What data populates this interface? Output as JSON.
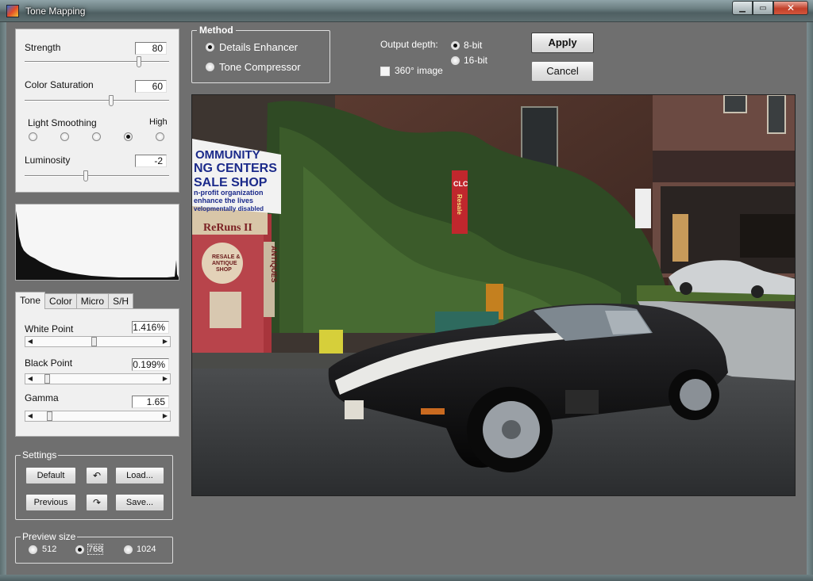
{
  "window": {
    "title": "Tone Mapping"
  },
  "adjust": {
    "strength": {
      "label": "Strength",
      "value": "80",
      "fraction": 0.8
    },
    "color_saturation": {
      "label": "Color Saturation",
      "value": "60",
      "fraction": 0.6
    },
    "light_smoothing": {
      "label": "Light Smoothing",
      "high_label": "High",
      "options": 5,
      "selected_index": 3
    },
    "luminosity": {
      "label": "Luminosity",
      "value": "-2",
      "fraction": 0.42
    }
  },
  "tabs": [
    {
      "label": "Tone",
      "active": true
    },
    {
      "label": "Color",
      "active": false
    },
    {
      "label": "Micro",
      "active": false
    },
    {
      "label": "S/H",
      "active": false
    }
  ],
  "tone": {
    "white_point": {
      "label": "White Point",
      "value": "1.416%",
      "fraction": 0.47
    },
    "black_point": {
      "label": "Black Point",
      "value": "0.199%",
      "fraction": 0.08
    },
    "gamma": {
      "label": "Gamma",
      "value": "1.65",
      "fraction": 0.1
    }
  },
  "settings": {
    "title": "Settings",
    "default_label": "Default",
    "load_label": "Load...",
    "previous_label": "Previous",
    "save_label": "Save..."
  },
  "preview_size": {
    "title": "Preview size",
    "options": [
      "512",
      "768",
      "1024"
    ],
    "selected": "768"
  },
  "method": {
    "title": "Method",
    "options": [
      "Details Enhancer",
      "Tone Compressor"
    ],
    "selected": "Details Enhancer"
  },
  "output": {
    "depth_label": "Output depth:",
    "depth_options": [
      "8-bit",
      "16-bit"
    ],
    "depth_selected": "8-bit",
    "image360_label": "360° image",
    "image360_checked": false
  },
  "actions": {
    "apply_label": "Apply",
    "cancel_label": "Cancel"
  },
  "preview_signs": {
    "community_line1": "OMMUNITY",
    "community_line2": "NG CENTERS",
    "community_line3": "SALE SHOP",
    "community_line4": "n-profit organization",
    "community_line5": "enhance the lives",
    "community_line6": "velopmentally disabled",
    "reruns": "ReRuns II",
    "resale_line1": "RESALE &",
    "resale_line2": "ANTIQUE",
    "resale_line3": "SHOP",
    "antiques": "ANTIQUES",
    "clc": "CLC",
    "resale_vertical": "Resale"
  },
  "colors": {
    "client_bg": "#6f6f6f",
    "panel_bg": "#f0f0f0",
    "title_text": "#ffffff"
  }
}
